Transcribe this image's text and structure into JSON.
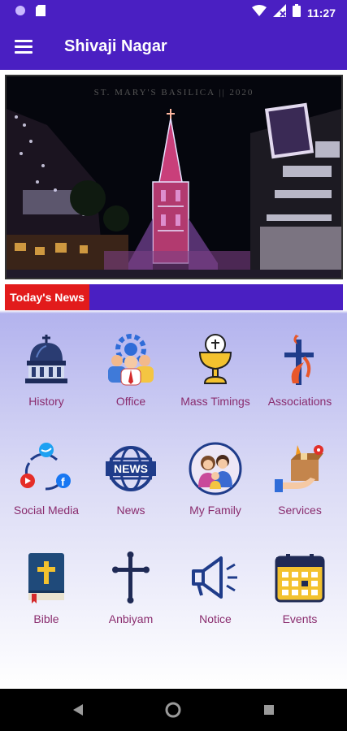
{
  "status_bar": {
    "time": "11:27"
  },
  "app_bar": {
    "title": "Shivaji Nagar"
  },
  "banner": {
    "caption": "ST. MARY'S BASILICA || 2020"
  },
  "news": {
    "label": "Today's News"
  },
  "grid": {
    "items": [
      {
        "label": "History",
        "icon": "church-dome-icon"
      },
      {
        "label": "Office",
        "icon": "office-people-icon"
      },
      {
        "label": "Mass Timings",
        "icon": "chalice-icon"
      },
      {
        "label": "Associations",
        "icon": "dove-cross-icon"
      },
      {
        "label": "Social Media",
        "icon": "social-network-icon"
      },
      {
        "label": "News",
        "icon": "news-globe-icon"
      },
      {
        "label": "My Family",
        "icon": "family-icon"
      },
      {
        "label": "Services",
        "icon": "services-box-icon"
      },
      {
        "label": "Bible",
        "icon": "bible-icon"
      },
      {
        "label": "Anbiyam",
        "icon": "cross-icon"
      },
      {
        "label": "Notice",
        "icon": "megaphone-icon"
      },
      {
        "label": "Events",
        "icon": "calendar-icon"
      }
    ]
  },
  "colors": {
    "primary": "#4a1fc2",
    "accent": "#e21b1b",
    "label": "#8a2c6e"
  }
}
